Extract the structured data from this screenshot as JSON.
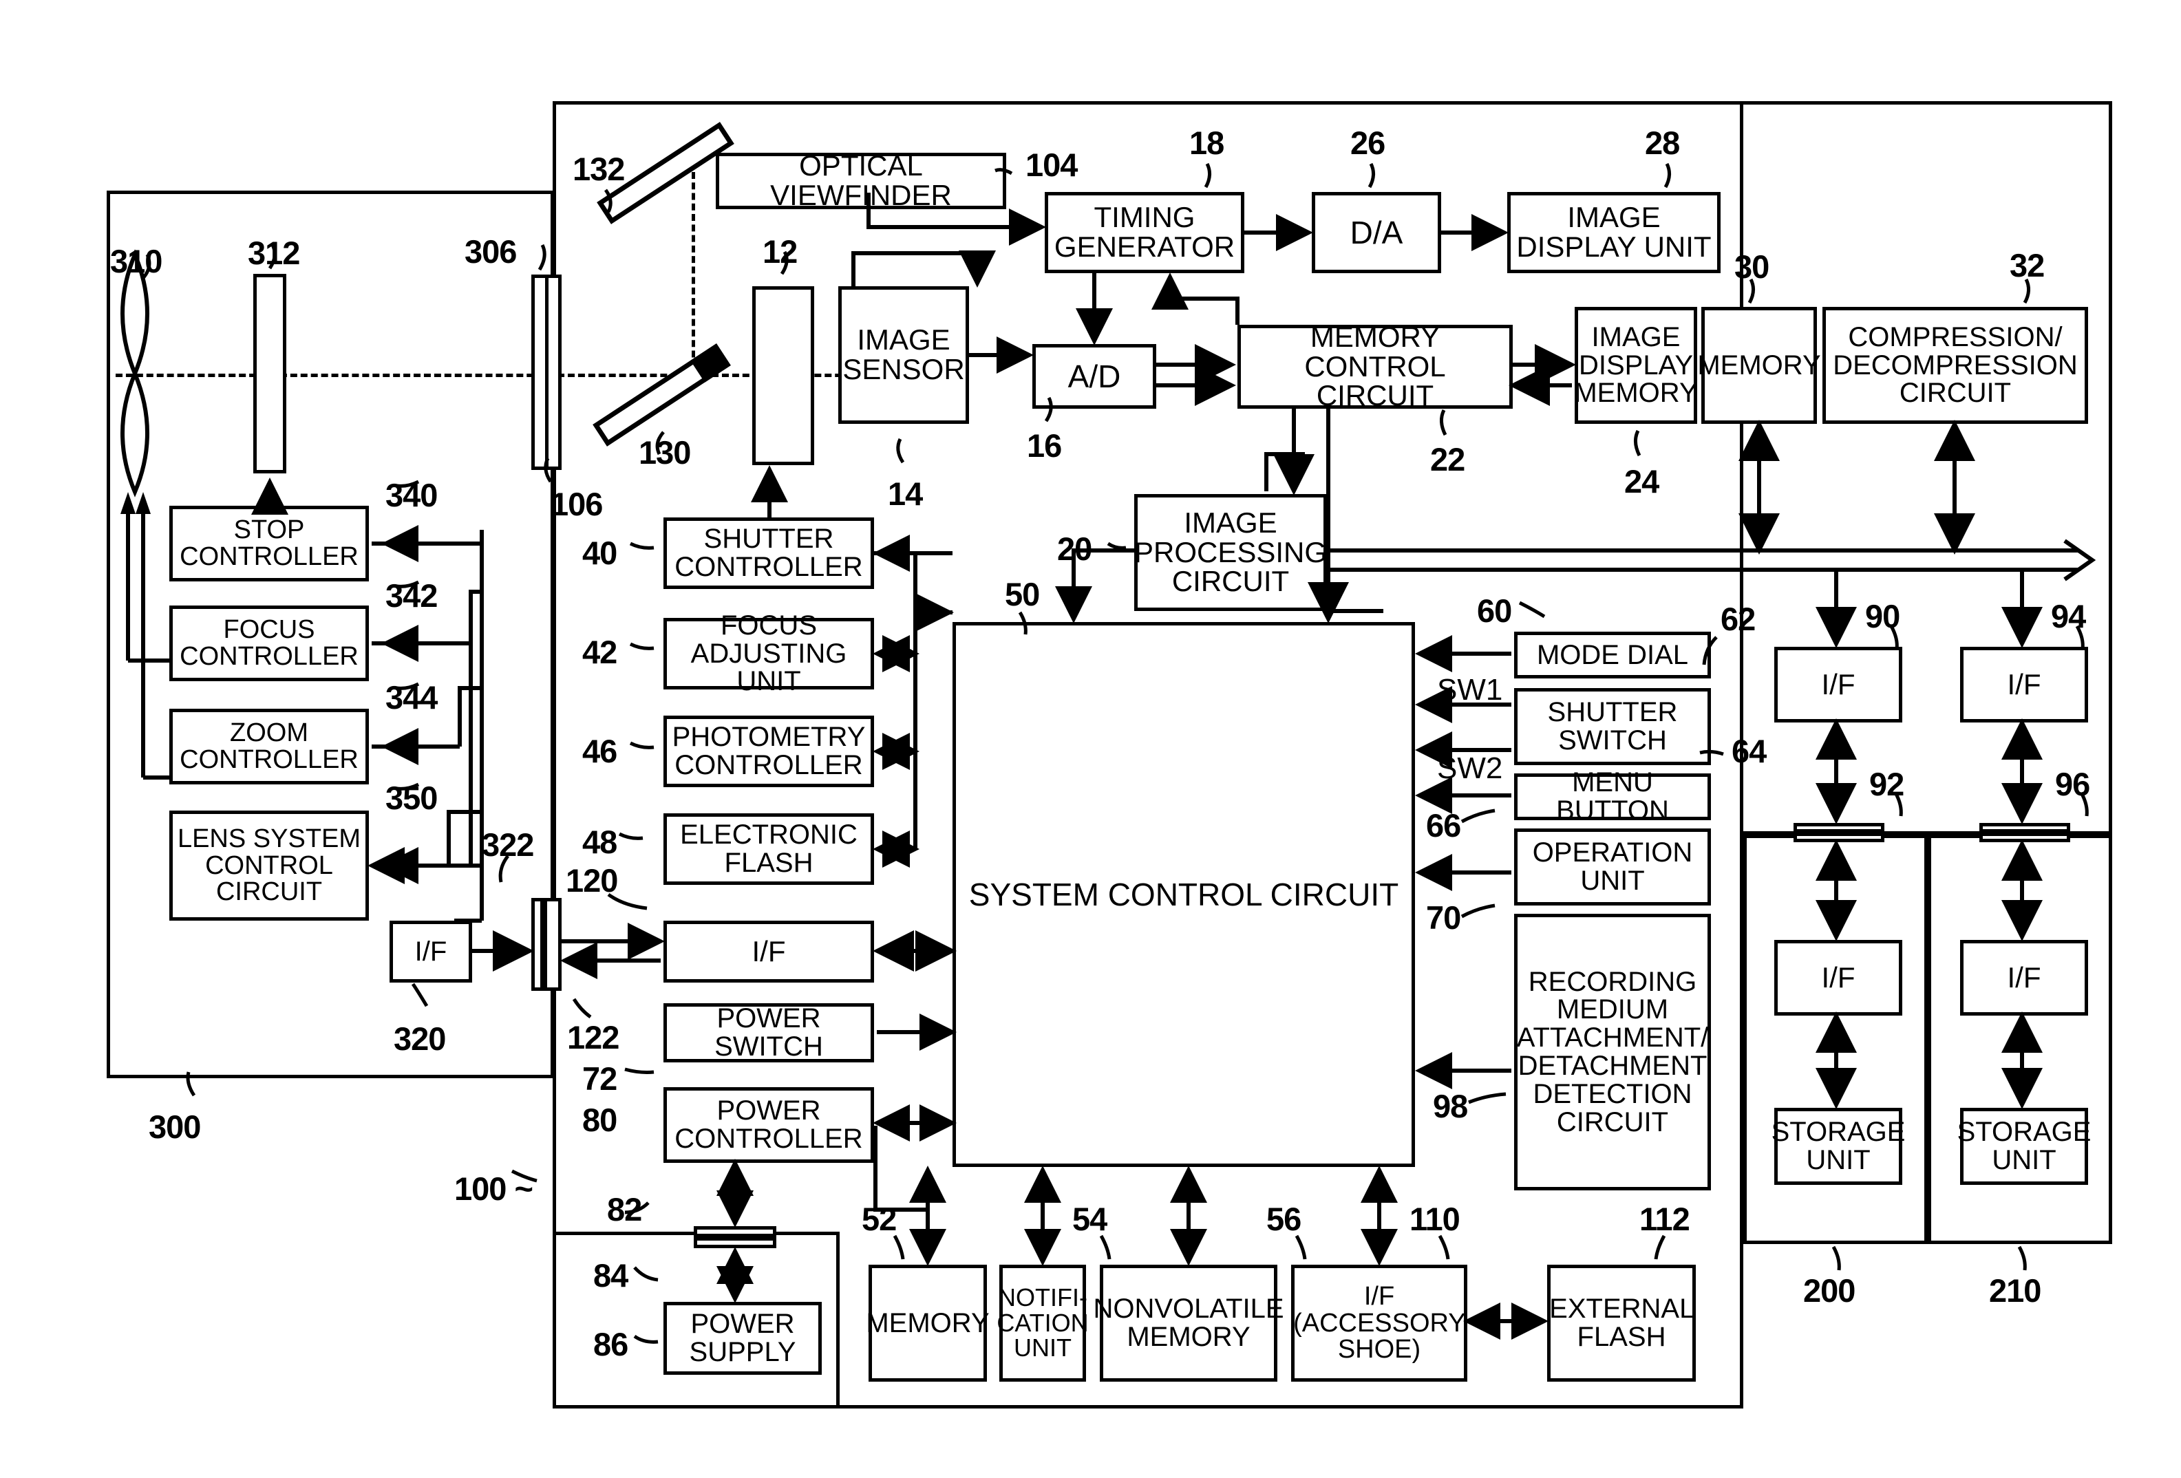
{
  "figure": {
    "type": "patent-block-diagram",
    "title": "Digital camera system block diagram",
    "domain": "Diagram"
  },
  "containers": [
    {
      "id": "lens-unit",
      "ref": "300",
      "role": "interchangeable lens unit enclosure"
    },
    {
      "id": "camera-body",
      "ref": "100",
      "role": "camera body enclosure"
    },
    {
      "id": "power-enclosure",
      "ref": "",
      "role": "power supply enclosure"
    },
    {
      "id": "recording-medium-200",
      "ref": "200",
      "role": "recording medium 1"
    },
    {
      "id": "recording-medium-210",
      "ref": "210",
      "role": "recording medium 2"
    }
  ],
  "blocks": {
    "optical_viewfinder": {
      "label": "OPTICAL VIEWFINDER",
      "ref": "104"
    },
    "timing_generator": {
      "label": "TIMING GENERATOR",
      "ref": "18"
    },
    "da": {
      "label": "D/A",
      "ref": "26"
    },
    "image_display_unit": {
      "label": "IMAGE DISPLAY UNIT",
      "ref": "28"
    },
    "image_sensor": {
      "label": "IMAGE SENSOR",
      "ref": "14"
    },
    "ad": {
      "label": "A/D",
      "ref": "16"
    },
    "memory_control_circuit": {
      "label": "MEMORY CONTROL CIRCUIT",
      "ref": "22"
    },
    "image_display_memory": {
      "label": "IMAGE DISPLAY MEMORY",
      "ref": "24"
    },
    "memory_30": {
      "label": "MEMORY",
      "ref": "30"
    },
    "compression": {
      "label": "COMPRESSION/ DECOMPRESSION CIRCUIT",
      "ref": "32"
    },
    "image_processing_circuit": {
      "label": "IMAGE PROCESSING CIRCUIT",
      "ref": "20"
    },
    "system_control_circuit": {
      "label": "SYSTEM CONTROL CIRCUIT",
      "ref": "50"
    },
    "shutter_controller": {
      "label": "SHUTTER CONTROLLER",
      "ref": "40"
    },
    "focus_adjusting_unit": {
      "label": "FOCUS ADJUSTING UNIT",
      "ref": "42"
    },
    "photometry_controller": {
      "label": "PHOTOMETRY CONTROLLER",
      "ref": "46"
    },
    "electronic_flash": {
      "label": "ELECTRONIC FLASH",
      "ref": "48"
    },
    "body_if": {
      "label": "I/F",
      "ref": "120"
    },
    "power_switch": {
      "label": "POWER SWITCH",
      "ref": "72"
    },
    "power_controller": {
      "label": "POWER CONTROLLER",
      "ref": "80"
    },
    "power_supply": {
      "label": "POWER SUPPLY",
      "ref": "86"
    },
    "memory_52": {
      "label": "MEMORY",
      "ref": "52"
    },
    "notification_unit": {
      "label": "NOTIFI- CATION UNIT",
      "ref": "54"
    },
    "nonvolatile_memory": {
      "label": "NONVOLATILE MEMORY",
      "ref": "56"
    },
    "accessory_shoe_if": {
      "label": "I/F (ACCESSORY SHOE)",
      "ref": "110"
    },
    "external_flash": {
      "label": "EXTERNAL FLASH",
      "ref": "112"
    },
    "mode_dial": {
      "label": "MODE DIAL",
      "ref": "60"
    },
    "shutter_switch": {
      "label": "SHUTTER SWITCH",
      "ref": "62"
    },
    "menu_button": {
      "label": "MENU BUTTON",
      "ref": "66"
    },
    "operation_unit": {
      "label": "OPERATION UNIT",
      "ref": "70"
    },
    "recording_detect": {
      "label": "RECORDING MEDIUM ATTACHMENT/ DETACHMENT DETECTION CIRCUIT",
      "ref": "98"
    },
    "if_90": {
      "label": "I/F",
      "ref": "90"
    },
    "if_94": {
      "label": "I/F",
      "ref": "94"
    },
    "if_200": {
      "label": "I/F",
      "ref": ""
    },
    "if_210": {
      "label": "I/F",
      "ref": ""
    },
    "storage_unit_200": {
      "label": "STORAGE UNIT",
      "ref": ""
    },
    "storage_unit_210": {
      "label": "STORAGE UNIT",
      "ref": ""
    },
    "stop_controller": {
      "label": "STOP CONTROLLER",
      "ref": "340"
    },
    "focus_controller": {
      "label": "FOCUS CONTROLLER",
      "ref": "342"
    },
    "zoom_controller": {
      "label": "ZOOM CONTROLLER",
      "ref": "344"
    },
    "lens_system_control_circuit": {
      "label": "LENS SYSTEM CONTROL CIRCUIT",
      "ref": "350"
    },
    "lens_if": {
      "label": "I/F",
      "ref": "320"
    }
  },
  "optics": {
    "lens_310": {
      "ref": "310",
      "desc": "photographic lens"
    },
    "stop_312": {
      "ref": "312",
      "desc": "stop/aperture"
    },
    "mount_306": {
      "ref": "306",
      "desc": "lens mount"
    },
    "mount_106": {
      "ref": "106",
      "desc": "body mount"
    },
    "mirror_132": {
      "ref": "132",
      "desc": "pentaprism / upper mirror"
    },
    "mirror_130": {
      "ref": "130",
      "desc": "quick return mirror"
    },
    "shutter_12": {
      "ref": "12",
      "desc": "mechanical shutter"
    },
    "connector_322": {
      "ref": "322",
      "desc": "lens side connector"
    },
    "connector_122": {
      "ref": "122",
      "desc": "body side connector"
    },
    "connector_82": {
      "ref": "82",
      "desc": "power connector body side"
    },
    "connector_84": {
      "ref": "84",
      "desc": "power connector supply side"
    },
    "connector_92": {
      "ref": "92",
      "desc": "recording medium connector 200"
    },
    "connector_96": {
      "ref": "96",
      "desc": "recording medium connector 210"
    }
  },
  "signal_labels": {
    "sw1": "SW1",
    "sw2": "SW2"
  },
  "reference_numerals": [
    "12",
    "14",
    "16",
    "18",
    "20",
    "22",
    "24",
    "26",
    "28",
    "30",
    "32",
    "40",
    "42",
    "46",
    "48",
    "50",
    "52",
    "54",
    "56",
    "60",
    "62",
    "64",
    "66",
    "70",
    "72",
    "80",
    "82",
    "84",
    "86",
    "90",
    "92",
    "94",
    "96",
    "98",
    "100",
    "104",
    "106",
    "110",
    "112",
    "120",
    "122",
    "130",
    "132",
    "200",
    "210",
    "300",
    "306",
    "310",
    "312",
    "320",
    "322",
    "340",
    "342",
    "344",
    "350"
  ],
  "colors": {
    "stroke": "#000000",
    "background": "#ffffff"
  }
}
